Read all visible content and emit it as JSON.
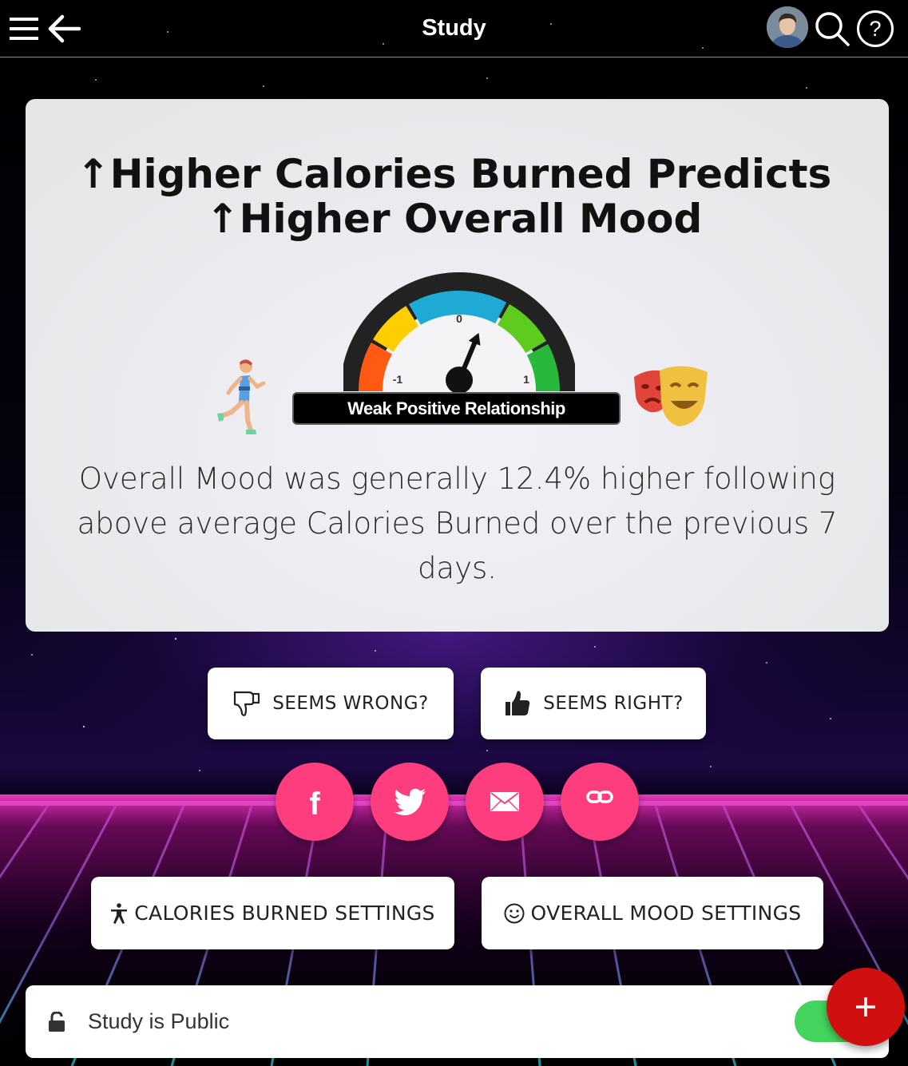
{
  "header": {
    "title": "Study",
    "icons": [
      "hamburger-menu-icon",
      "back-arrow-icon",
      "user-avatar",
      "search-icon",
      "help-icon"
    ]
  },
  "study_card": {
    "title_line1": "↑Higher Calories Burned Predicts",
    "title_line2": "↑Higher Overall Mood",
    "gauge": {
      "label": "Weak Positive Relationship",
      "tick_min": "-1",
      "tick_mid": "0",
      "tick_max": "1",
      "value": 0.25
    },
    "left_emoji": "runner",
    "right_emoji": "performing-arts",
    "summary": "Overall Mood was generally 12.4% higher following above average Calories Burned over the previous 7 days."
  },
  "vote": {
    "wrong_label": "SEEMS WRONG?",
    "right_label": "SEEMS RIGHT?"
  },
  "share": {
    "buttons": [
      "facebook-icon",
      "twitter-icon",
      "email-icon",
      "link-icon"
    ],
    "facebook_glyph": "f"
  },
  "settings": {
    "cause_label": "CALORIES BURNED SETTINGS",
    "effect_label": "OVERALL MOOD SETTINGS"
  },
  "privacy": {
    "label": "Study is Public",
    "is_public": true
  },
  "fab": {
    "symbol": "+"
  },
  "colors": {
    "share_pink": "#fe3d7f",
    "fab_red": "#d01010",
    "toggle_green": "#44d45e"
  }
}
